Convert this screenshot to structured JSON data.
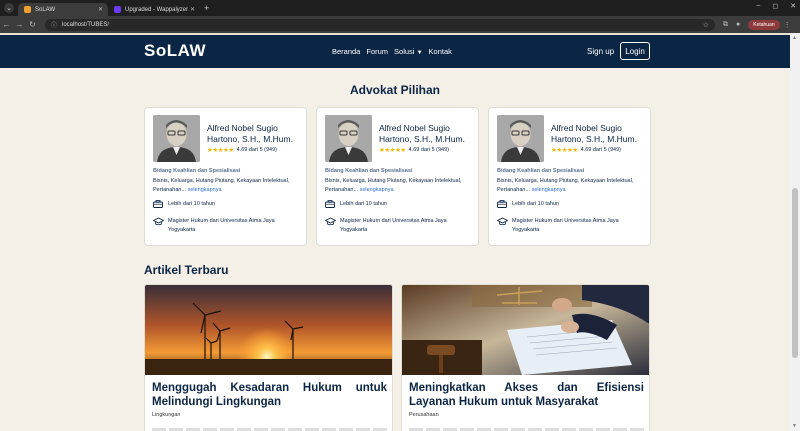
{
  "browser": {
    "tabs": [
      {
        "title": "SoLAW",
        "active": true,
        "favicon_color": "#f0a030"
      },
      {
        "title": "Upgraded - Wappalyzer",
        "active": false,
        "favicon_color": "#6a3df0"
      }
    ],
    "new_tab": "+",
    "url": "localhost/TUBES/",
    "profile_label": "Ketahuan",
    "controls": {
      "minimize": "–",
      "maximize": "◻",
      "close": "✕"
    }
  },
  "site": {
    "logo": "SoLAW",
    "nav": {
      "beranda": "Beranda",
      "forum": "Forum",
      "solusi": "Solusi",
      "kontak": "Kontak"
    },
    "signup": "Sign up",
    "login": "Login",
    "brand_color": "#0b2545"
  },
  "advokat_section": {
    "title": "Advokat Pilihan",
    "cards": [
      {
        "name": "Alfred Nobel Sugio Hartono, S.H., M.Hum.",
        "rating": "4.69 dari 5 (949)",
        "stars": "★★★★★",
        "expertise_title": "Bidang Keahlian dan Spesialisasi",
        "expertise": "Bisnis, Keluarga, Hutang Piutang, Kekayaan Intelektual, Pertanahan...",
        "more": "selengkapnya",
        "experience": "Lebih dari 10 tahun",
        "education": "Magister Hukum dari Universitas Atma Jaya Yogyakarta"
      },
      {
        "name": "Alfred Nobel Sugio Hartono, S.H., M.Hum.",
        "rating": "4.69 dari 5 (949)",
        "stars": "★★★★★",
        "expertise_title": "Bidang Keahlian dan Spesialisasi",
        "expertise": "Bisnis, Keluarga, Hutang Piutang, Kekayaan Intelektual, Pertanahan...",
        "more": "selengkapnya",
        "experience": "Lebih dari 10 tahun",
        "education": "Magister Hukum dari Universitas Atma Jaya Yogyakarta"
      },
      {
        "name": "Alfred Nobel Sugio Hartono, S.H., M.Hum.",
        "rating": "4.69 dari 5 (949)",
        "stars": "★★★★★",
        "expertise_title": "Bidang Keahlian dan Spesialisasi",
        "expertise": "Bisnis, Keluarga, Hutang Piutang, Kekayaan Intelektual, Pertanahan...",
        "more": "selengkapnya",
        "experience": "Lebih dari 10 tahun",
        "education": "Magister Hukum dari Universitas Atma Jaya Yogyakarta"
      }
    ]
  },
  "artikel_section": {
    "title": "Artikel Terbaru",
    "articles": [
      {
        "title": "Menggugah Kesadaran Hukum untuk Melindungi Lingkungan",
        "category": "Lingkungan",
        "image": "wind-turbines-sunset-image"
      },
      {
        "title": "Meningkatkan Akses dan Efisiensi Layanan Hukum untuk Masyarakat",
        "category": "Perusahaan",
        "image": "gavel-document-signing-image"
      }
    ]
  }
}
